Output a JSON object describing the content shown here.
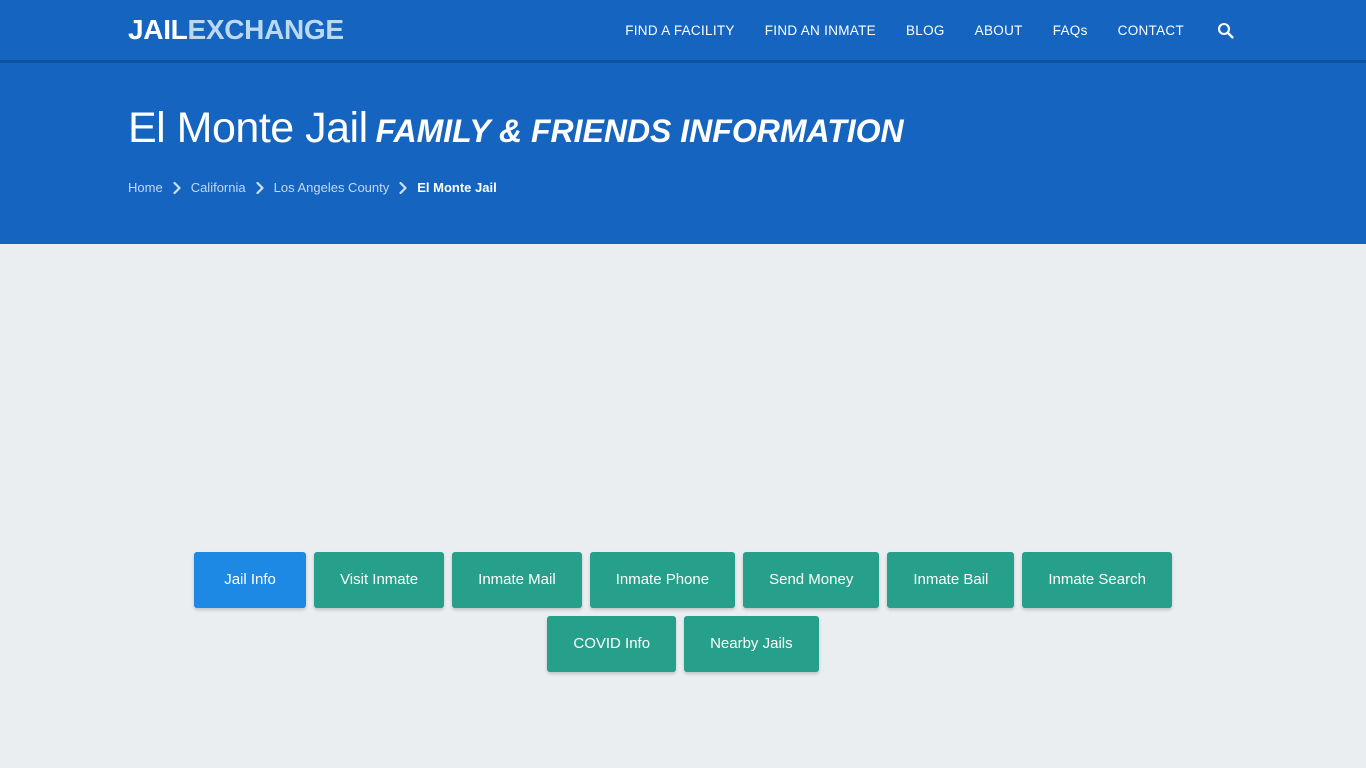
{
  "site": {
    "logo_primary": "JAIL",
    "logo_secondary": "EXCHANGE"
  },
  "nav": {
    "items": [
      {
        "label": "FIND A FACILITY"
      },
      {
        "label": "FIND AN INMATE"
      },
      {
        "label": "BLOG"
      },
      {
        "label": "ABOUT"
      },
      {
        "label": "FAQs"
      },
      {
        "label": "CONTACT"
      }
    ],
    "search_icon": "search-icon"
  },
  "hero": {
    "title_main": "El Monte Jail",
    "title_sub": "FAMILY & FRIENDS INFORMATION",
    "breadcrumb": [
      {
        "label": "Home",
        "current": false
      },
      {
        "label": "California",
        "current": false
      },
      {
        "label": "Los Angeles County",
        "current": false
      },
      {
        "label": "El Monte Jail",
        "current": true
      }
    ],
    "separator_icon": "chevron-right-icon"
  },
  "tabs": {
    "row1": [
      {
        "label": "Jail Info",
        "active": true
      },
      {
        "label": "Visit Inmate",
        "active": false
      },
      {
        "label": "Inmate Mail",
        "active": false
      },
      {
        "label": "Inmate Phone",
        "active": false
      },
      {
        "label": "Send Money",
        "active": false
      },
      {
        "label": "Inmate Bail",
        "active": false
      },
      {
        "label": "Inmate Search",
        "active": false
      }
    ],
    "row2": [
      {
        "label": "COVID Info",
        "active": false
      },
      {
        "label": "Nearby Jails",
        "active": false
      }
    ]
  },
  "colors": {
    "brand_blue": "#1565c0",
    "navbar_divider": "#0f529f",
    "active_tab_blue": "#1e88e5",
    "tab_teal": "#26a08a",
    "body_bg": "#eaeef1",
    "logo_secondary": "#bcd9f2",
    "breadcrumb_link": "#c3d9f0"
  }
}
